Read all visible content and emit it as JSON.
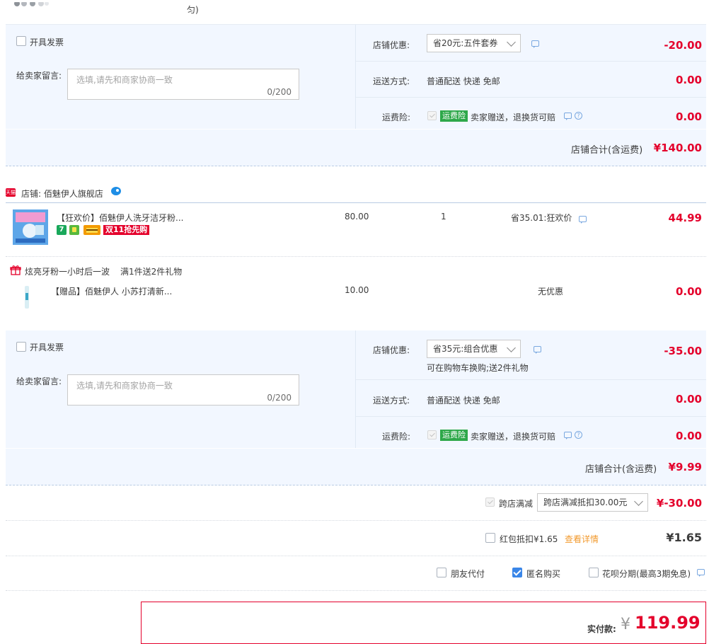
{
  "top_fragment": {
    "text": "匀)"
  },
  "shop1": {
    "invoice_label": "开具发票",
    "message_label": "给卖家留言:",
    "message_placeholder": "选填,请先和商家协商一致",
    "message_counter": "0/200",
    "discount_label": "店铺优惠:",
    "discount_value": "省20元:五件套券",
    "discount_amount": "-20.00",
    "shipping_label": "运送方式:",
    "shipping_value": "普通配送 快递 免邮",
    "shipping_amount": "0.00",
    "insurance_label": "运费险:",
    "insurance_tag": "运费险",
    "insurance_text": "卖家赠送，退换货可赔",
    "insurance_amount": "0.00",
    "total_label": "店铺合计(含运费)",
    "total_amount": "¥140.00"
  },
  "shop2": {
    "badge": "天猫",
    "name": "店铺: 佰魅伊人旗舰店",
    "item": {
      "title": "【狂欢价】佰魅伊人洗牙洁牙粉...",
      "tag_7": "7",
      "promo_tag": "双11抢先购",
      "price": "80.00",
      "qty": "1",
      "discount": "省35.01:狂欢价",
      "subtotal": "44.99"
    },
    "gift_promo": {
      "text": "炫亮牙粉一小时后一波",
      "rule": "满1件送2件礼物"
    },
    "gift_item": {
      "title": "【赠品】佰魅伊人 小苏打清新...",
      "price": "10.00",
      "discount": "无优惠",
      "subtotal": "0.00"
    },
    "invoice_label": "开具发票",
    "message_label": "给卖家留言:",
    "message_placeholder": "选填,请先和商家协商一致",
    "message_counter": "0/200",
    "discount_label": "店铺优惠:",
    "discount_value": "省35元:组合优惠",
    "discount_note": "可在购物车换购;送2件礼物",
    "discount_amount": "-35.00",
    "shipping_label": "运送方式:",
    "shipping_value": "普通配送 快递 免邮",
    "shipping_amount": "0.00",
    "insurance_label": "运费险:",
    "insurance_tag": "运费险",
    "insurance_text": "卖家赠送，退换货可赔",
    "insurance_amount": "0.00",
    "total_label": "店铺合计(含运费)",
    "total_amount": "¥9.99"
  },
  "cross_store": {
    "label": "跨店满减",
    "select_value": "跨店满减抵扣30.00元",
    "amount": "¥-30.00"
  },
  "red_packet": {
    "label": "红包抵扣¥1.65",
    "link": "查看详情",
    "amount": "¥1.65"
  },
  "options": {
    "friend_pay": "朋友代付",
    "anonymous": "匿名购买",
    "installment": "花呗分期(最高3期免息)"
  },
  "final": {
    "label": "实付款:",
    "currency": "¥",
    "amount": "119.99"
  },
  "colors": {
    "accent_red": "#e4002b",
    "panel_bg": "#f2f7ff",
    "check_blue": "#3a86e8",
    "insurance_green": "#2ea84a"
  }
}
